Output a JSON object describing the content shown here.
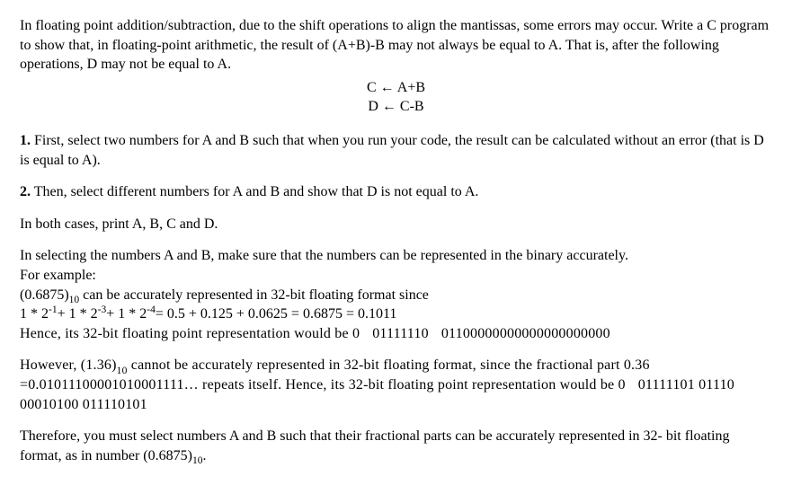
{
  "intro": {
    "text": "In floating point addition/subtraction, due to the shift operations to align the mantissas, some errors may occur. Write a C program to show that, in floating-point arithmetic, the result of (A+B)-B may not always be equal to A. That is, after the following operations, D may not be equal to A."
  },
  "ops": {
    "line1": "C ← A+B",
    "line2": "D ← C-B"
  },
  "step1": {
    "num": "1.",
    "text": " First, select two numbers for A and B such that when you run your code, the result can be calculated without an error (that is D is equal to A)."
  },
  "step2": {
    "num": "2.",
    "text": " Then, select different numbers for A and B and show that D is not equal to A."
  },
  "both_cases": "In both cases, print A, B, C and D.",
  "select_note": "In selecting the numbers A and B, make sure that the numbers can be represented in the binary accurately.",
  "example_label": "For example:",
  "example_num": {
    "prefix": "(0.6875)",
    "sub": "10",
    "suffix": " can be accurately represented in 32-bit floating format since"
  },
  "example_eq": {
    "pre": " 1 * 2",
    "e1": "-1",
    "mid1": "+ 1 * 2",
    "e2": "-3",
    "mid2": "+ 1 * 2",
    "e3": "-4",
    "tail": "= 0.5 + 0.125 + 0.0625 = 0.6875 = 0.1011"
  },
  "hence1": {
    "prefix": "Hence, its 32-bit floating point representation would be 0",
    "exp": "01111110",
    "mant": "01100000000000000000000"
  },
  "however": {
    "part1_prefix": "However, (1.36)",
    "part1_sub": "10",
    "part1_suffix": " cannot be accurately represented in 32-bit floating format, since the fractional part 0.36 =0.01011100001010001111… repeats itself. Hence, its 32-bit floating point representation would be 0",
    "exp": "01111101",
    "mant": "01110 00010100 011110101"
  },
  "therefore": {
    "prefix": "Therefore, you must select numbers A and B such that their fractional parts can be accurately represented in 32- bit floating format, as in number (0.6875)",
    "sub": "10",
    "suffix": "."
  }
}
